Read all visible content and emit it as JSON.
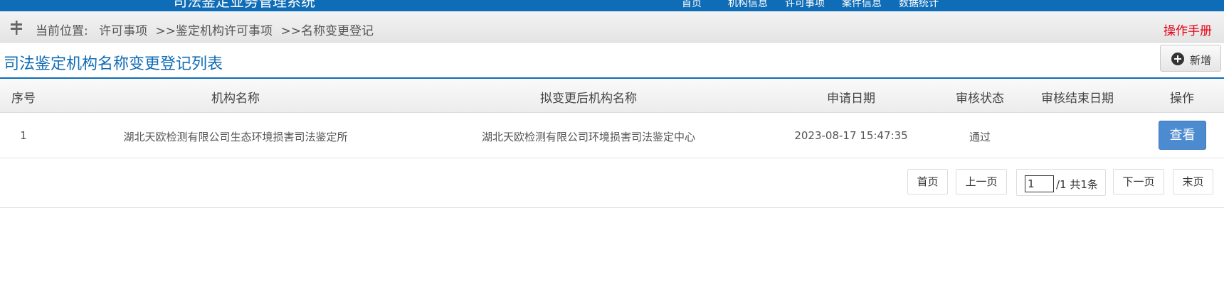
{
  "header": {
    "app_title": "司法鉴定业务管理系统",
    "nav": [
      "首页",
      "机构信息",
      "许可事项",
      "案件信息",
      "数据统计"
    ]
  },
  "breadcrumb": {
    "label": "当前位置:",
    "items": [
      "许可事项",
      ">>鉴定机构许可事项",
      ">>名称变更登记"
    ],
    "manual_link": "操作手册"
  },
  "page": {
    "title": "司法鉴定机构名称变更登记列表",
    "add_button": "新增",
    "add_icon": "plus-circle-icon"
  },
  "table": {
    "columns": [
      "序号",
      "机构名称",
      "拟变更后机构名称",
      "申请日期",
      "审核状态",
      "审核结束日期",
      "操作"
    ],
    "rows": [
      {
        "index": "1",
        "org_name": "湖北天欧检测有限公司生态环境损害司法鉴定所",
        "new_name": "湖北天欧检测有限公司环境损害司法鉴定中心",
        "apply_date": "2023-08-17 15:47:35",
        "status": "通过",
        "end_date": "",
        "action": "查看"
      }
    ]
  },
  "pagination": {
    "first": "首页",
    "prev": "上一页",
    "current_page": "1",
    "total_text": "/1 共1条",
    "next": "下一页",
    "last": "末页"
  },
  "colors": {
    "brand": "#0f6cb6",
    "manual_link": "#e60012",
    "view_button": "#4d8bd1"
  }
}
